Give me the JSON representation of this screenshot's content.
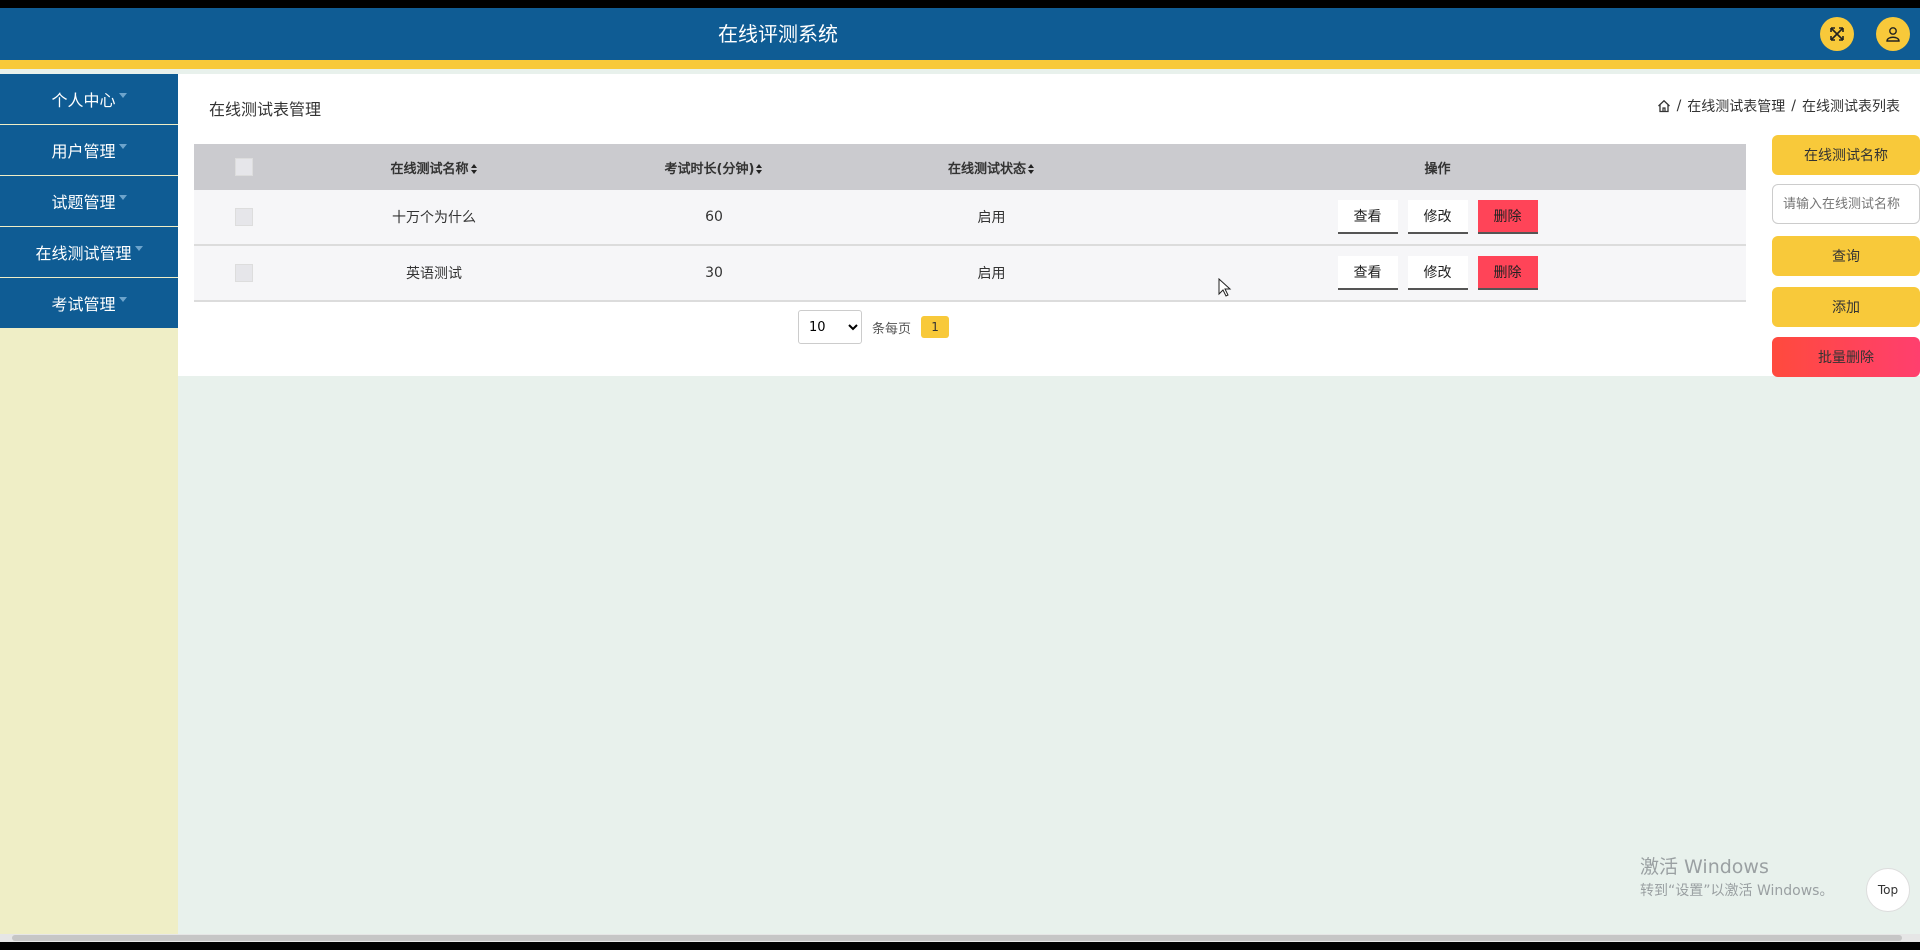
{
  "header": {
    "title": "在线评测系统",
    "fullscreen_icon": "expand-icon",
    "user_icon": "user-icon"
  },
  "sidebar": {
    "items": [
      {
        "label": "个人中心"
      },
      {
        "label": "用户管理"
      },
      {
        "label": "试题管理"
      },
      {
        "label": "在线测试管理"
      },
      {
        "label": "考试管理"
      }
    ]
  },
  "page": {
    "title": "在线测试表管理",
    "breadcrumb": {
      "home_icon": "home-icon",
      "item1": "在线测试表管理",
      "item2": "在线测试表列表",
      "sep": "/"
    }
  },
  "table": {
    "columns": {
      "name": "在线测试名称",
      "duration": "考试时长(分钟)",
      "status": "在线测试状态",
      "ops": "操作"
    },
    "rows": [
      {
        "name": "十万个为什么",
        "duration": "60",
        "status": "启用"
      },
      {
        "name": "英语测试",
        "duration": "30",
        "status": "启用"
      }
    ],
    "actions": {
      "view": "查看",
      "edit": "修改",
      "delete": "删除"
    }
  },
  "pagination": {
    "page_size": "10",
    "page_size_options": [
      "10"
    ],
    "per_page_label": "条每页",
    "current_page": "1"
  },
  "right_panel": {
    "filter_label": "在线测试名称",
    "search_placeholder": "请输入在线测试名称",
    "search_button": "查询",
    "add_button": "添加",
    "batch_delete_button": "批量删除"
  },
  "watermark": {
    "title": "激活 Windows",
    "subtitle": "转到“设置”以激活 Windows。"
  },
  "top_button": "Top",
  "colors": {
    "primary": "#0f5c94",
    "accent": "#f8c93a",
    "danger": "#ff4458"
  }
}
